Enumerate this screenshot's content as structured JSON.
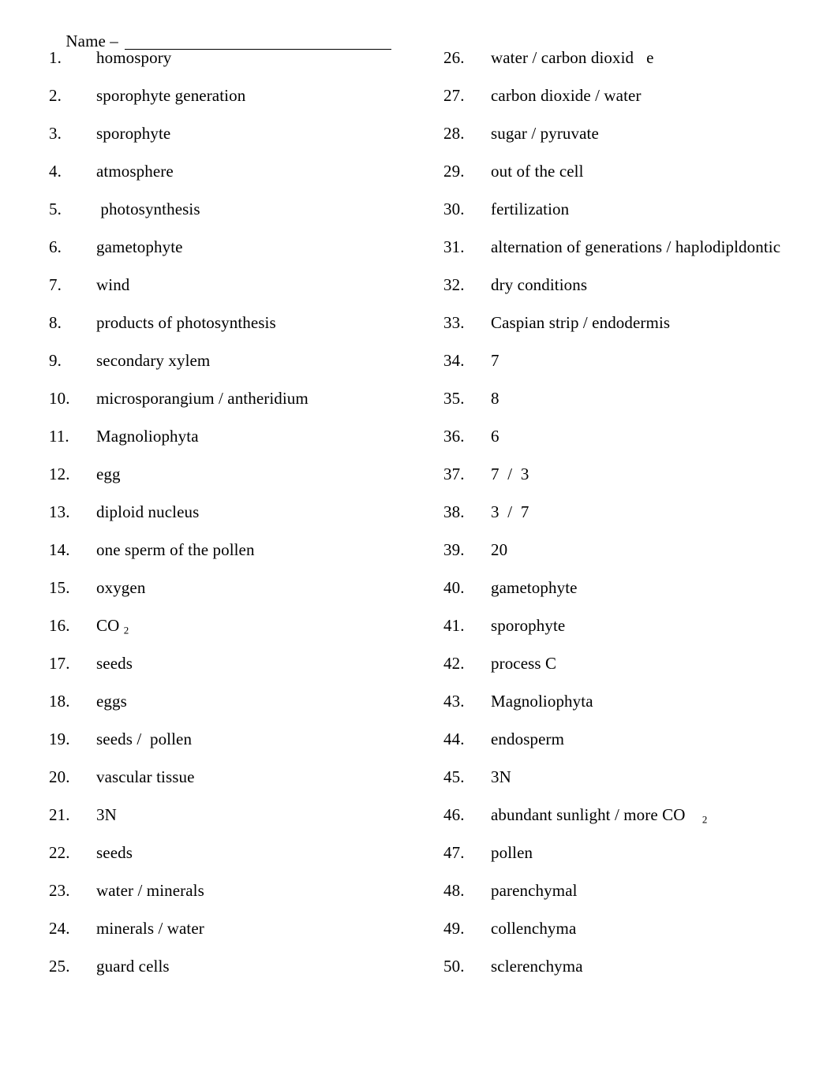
{
  "document": {
    "header": {
      "name_label": "Name – ",
      "name_rule": ""
    },
    "columns": {
      "left": [
        {
          "num": "1.",
          "text": "homospory"
        },
        {
          "num": "2.",
          "text": "sporophyte generation"
        },
        {
          "num": "3.",
          "text": "sporophyte"
        },
        {
          "num": "4.",
          "text": "atmosphere"
        },
        {
          "num": "5.",
          "text": " photosynthesis"
        },
        {
          "num": "6.",
          "text": "gametophyte"
        },
        {
          "num": "7.",
          "text": "wind"
        },
        {
          "num": "8.",
          "text": "products of photosynthesis"
        },
        {
          "num": "9.",
          "text": "secondary xylem"
        },
        {
          "num": "10.",
          "text": "microsporangium / antheridium"
        },
        {
          "num": "11.",
          "text": "Magnoliophyta"
        },
        {
          "num": "12.",
          "text": "egg"
        },
        {
          "num": "13.",
          "text": "diploid nucleus"
        },
        {
          "num": "14.",
          "text": "one sperm of the pollen"
        },
        {
          "num": "15.",
          "text": "oxygen"
        },
        {
          "num": "16.",
          "text": "CO",
          "sub": "2",
          "sub_gap": "small"
        },
        {
          "num": "17.",
          "text": "seeds"
        },
        {
          "num": "18.",
          "text": "eggs"
        },
        {
          "num": "19.",
          "text": "seeds /  pollen"
        },
        {
          "num": "20.",
          "text": "vascular tissue"
        },
        {
          "num": "21.",
          "text": "3N"
        },
        {
          "num": "22.",
          "text": "seeds"
        },
        {
          "num": "23.",
          "text": "water / minerals"
        },
        {
          "num": "24.",
          "text": "minerals / water"
        },
        {
          "num": "25.",
          "text": "guard cells"
        }
      ],
      "right": [
        {
          "num": "26.",
          "text": "water / carbon dioxid   e"
        },
        {
          "num": "27.",
          "text": "carbon dioxide / water"
        },
        {
          "num": "28.",
          "text": "sugar / pyruvate"
        },
        {
          "num": "29.",
          "text": "out of the cell"
        },
        {
          "num": "30.",
          "text": "fertilization"
        },
        {
          "num": "31.",
          "text": "alternation of generations / haplodipldontic"
        },
        {
          "num": "32.",
          "text": "dry conditions"
        },
        {
          "num": "33.",
          "text": "Caspian strip / endodermis"
        },
        {
          "num": "34.",
          "text": "7"
        },
        {
          "num": "35.",
          "text": "8"
        },
        {
          "num": "36.",
          "text": "6"
        },
        {
          "num": "37.",
          "text": "7  /  3"
        },
        {
          "num": "38.",
          "text": "3  /  7"
        },
        {
          "num": "39.",
          "text": "20"
        },
        {
          "num": "40.",
          "text": "gametophyte"
        },
        {
          "num": "41.",
          "text": "sporophyte"
        },
        {
          "num": "42.",
          "text": "process C"
        },
        {
          "num": "43.",
          "text": "Magnoliophyta"
        },
        {
          "num": "44.",
          "text": "endosperm"
        },
        {
          "num": "45.",
          "text": "3N"
        },
        {
          "num": "46.",
          "text": "abundant sunlight / more CO",
          "sub": "2",
          "sub_gap": "large"
        },
        {
          "num": "47.",
          "text": "pollen"
        },
        {
          "num": "48.",
          "text": "parenchymal"
        },
        {
          "num": "49.",
          "text": "collenchyma"
        },
        {
          "num": "50.",
          "text": "sclerenchyma"
        }
      ]
    }
  }
}
